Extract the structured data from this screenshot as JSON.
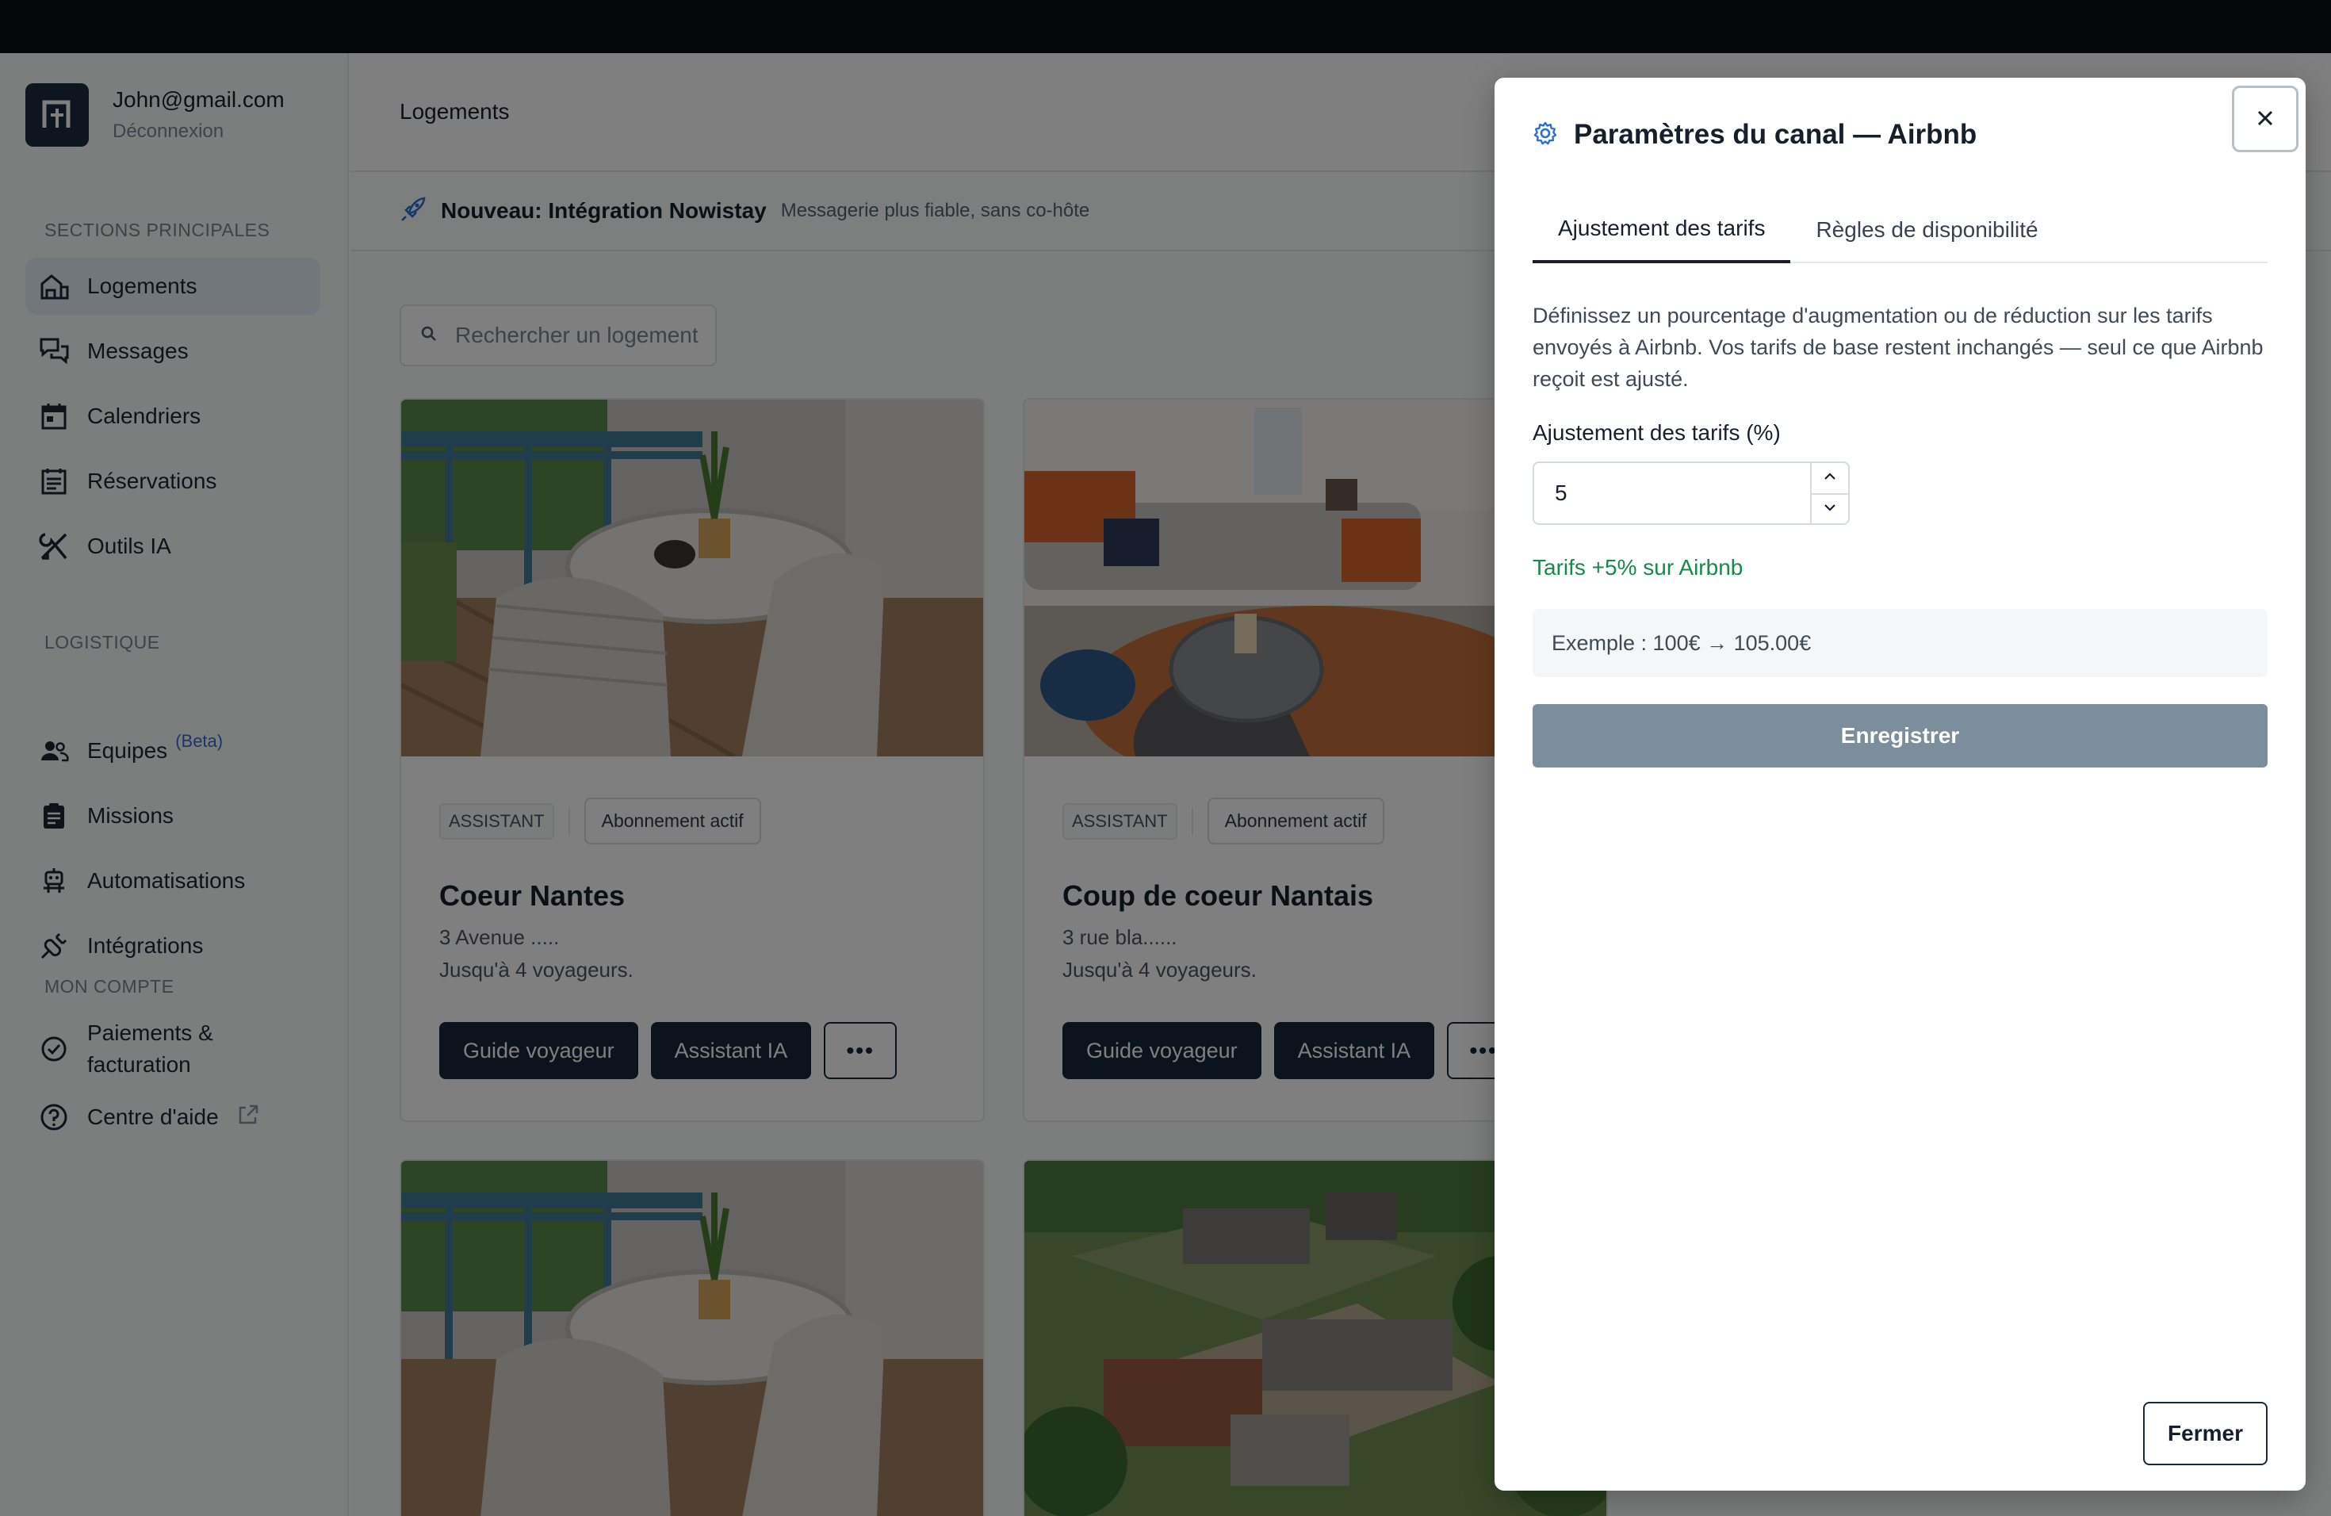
{
  "account": {
    "email": "John@gmail.com",
    "logout": "Déconnexion"
  },
  "sidebar": {
    "sections": {
      "main": "SECTIONS PRINCIPALES",
      "logistics": "LOGISTIQUE",
      "account": "MON COMPTE"
    },
    "items": [
      {
        "label": "Logements",
        "icon": "house-icon"
      },
      {
        "label": "Messages",
        "icon": "chat-bubbles-icon"
      },
      {
        "label": "Calendriers",
        "icon": "calendar-icon"
      },
      {
        "label": "Réservations",
        "icon": "list-doc-icon"
      },
      {
        "label": "Outils IA",
        "icon": "tools-icon"
      },
      {
        "label": "Equipes",
        "icon": "team-icon",
        "badge": "(Beta)"
      },
      {
        "label": "Missions",
        "icon": "clipboard-icon"
      },
      {
        "label": "Automatisations",
        "icon": "robot-icon"
      },
      {
        "label": "Intégrations",
        "icon": "plug-icon"
      },
      {
        "label": "Paiements &",
        "label2": "facturation",
        "icon": "billing-badge-icon"
      },
      {
        "label": "Centre d'aide",
        "icon": "help-circle-icon"
      }
    ]
  },
  "header": {
    "title": "Logements"
  },
  "banner": {
    "title": "Nouveau: Intégration Nowistay",
    "subtitle": "Messagerie plus fiable, sans co-hôte"
  },
  "search": {
    "placeholder": "Rechercher un logement"
  },
  "listings": [
    {
      "badge_type": "ASSISTANT",
      "badge_status": "Abonnement actif",
      "title": "Coeur Nantes",
      "address": "3 Avenue .....",
      "capacity": "Jusqu'à 4 voyageurs.",
      "btn_guide": "Guide voyageur",
      "btn_assistant": "Assistant IA",
      "more": "•••"
    },
    {
      "badge_type": "ASSISTANT",
      "badge_status": "Abonnement actif",
      "title": "Coup de coeur Nantais",
      "address": "3 rue bla......",
      "capacity": "Jusqu'à 4 voyageurs.",
      "btn_guide": "Guide voyageur",
      "btn_assistant": "Assistant IA",
      "more": "•••"
    }
  ],
  "drawer": {
    "title": "Paramètres du canal — Airbnb",
    "tabs": [
      {
        "label": "Ajustement des tarifs",
        "active": true
      },
      {
        "label": "Règles de disponibilité",
        "active": false
      }
    ],
    "description": "Définissez un pourcentage d'augmentation ou de réduction sur les tarifs envoyés à Airbnb. Vos tarifs de base restent inchangés — seul ce que Airbnb reçoit est ajusté.",
    "field_label": "Ajustement des tarifs (%)",
    "field_value": "5",
    "status": "Tarifs +5% sur Airbnb",
    "example": "Exemple : 100€ → 105.00€",
    "save_label": "Enregistrer",
    "close_label": "Fermer"
  },
  "colors": {
    "primary_dark": "#16283a",
    "success": "#168a4a",
    "save_disabled": "#7b8e9b",
    "accent_blue": "#2a6fd6"
  }
}
